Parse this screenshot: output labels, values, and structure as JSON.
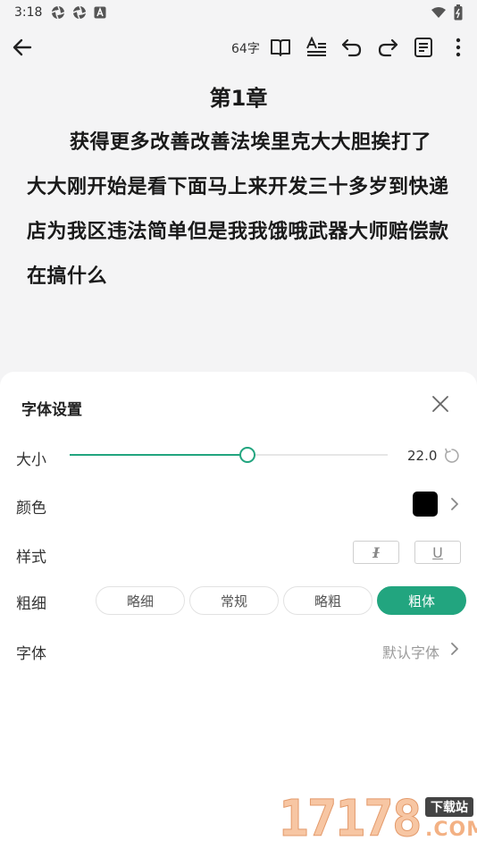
{
  "status": {
    "time": "3:18",
    "notification_icons": [
      "aperture-icon",
      "aperture-icon",
      "a-box-icon"
    ],
    "right_icons": [
      "wifi-icon",
      "battery-icon"
    ]
  },
  "toolbar": {
    "word_count": "64字"
  },
  "reader": {
    "chapter_title": "第1章",
    "body": "获得更多改善改善法埃里克大大胆挨打了大大刚开始是看下面马上来开发三十多岁到快递店为我区违法简单但是我我饿哦武器大师赔偿款在搞什么"
  },
  "font_settings": {
    "title": "字体设置",
    "size": {
      "label": "大小",
      "value": "22.0",
      "slider_fraction": 0.56
    },
    "color": {
      "label": "颜色",
      "value_hex": "#000000"
    },
    "style": {
      "label": "样式",
      "italic_glyph": "I",
      "underline_glyph": "U"
    },
    "weight": {
      "label": "粗细",
      "options": [
        "略细",
        "常规",
        "略粗",
        "粗体"
      ],
      "selected": "粗体"
    },
    "font": {
      "label": "字体",
      "value": "默认字体"
    }
  },
  "colors": {
    "accent": "#22a57f",
    "background": "#f4f4f5",
    "sheet": "#ffffff"
  },
  "watermark": {
    "digits": "17178",
    "tag": "下载站",
    "suffix": ".COM"
  }
}
